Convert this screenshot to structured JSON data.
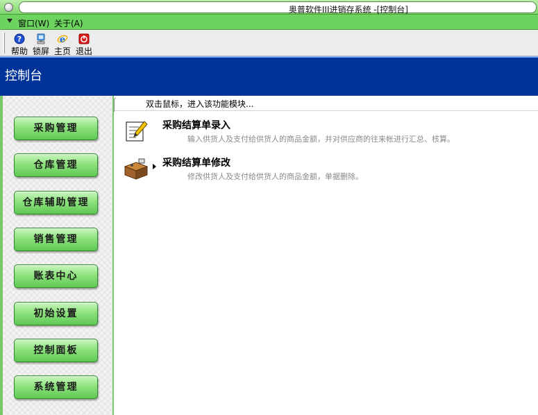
{
  "window": {
    "title": "奥普软件III进销存系统 -[控制台]"
  },
  "menu": {
    "items": [
      {
        "label": "窗口(W)"
      },
      {
        "label": "关于(A)"
      }
    ]
  },
  "toolbar": {
    "buttons": [
      {
        "label": "帮助",
        "icon": "help-icon"
      },
      {
        "label": "锁屏",
        "icon": "lock-screen-icon"
      },
      {
        "label": "主页",
        "icon": "home-ie-icon"
      },
      {
        "label": "退出",
        "icon": "exit-power-icon"
      }
    ]
  },
  "header": {
    "title": "控制台"
  },
  "sidebar": {
    "items": [
      {
        "label": "采购管理"
      },
      {
        "label": "仓库管理"
      },
      {
        "label": "仓库辅助管理"
      },
      {
        "label": "销售管理"
      },
      {
        "label": "账表中心"
      },
      {
        "label": "初始设置"
      },
      {
        "label": "控制面板"
      },
      {
        "label": "系统管理"
      }
    ]
  },
  "content": {
    "hint": "双击鼠标，进入该功能模块...",
    "functions": [
      {
        "name": "采购结算单录入",
        "description": "输入供货人及支付给供货人的商品金额，并对供应商的往来帐进行汇总、核算。",
        "icon": "notepad-pencil-icon"
      },
      {
        "name": "采购结算单修改",
        "description": "修改供货人及支付给供货人的商品金额，单据删除。",
        "icon": "desk-edit-icon"
      }
    ]
  },
  "colors": {
    "menu_green": "#6cd45e",
    "header_blue": "#003399",
    "nav_button_green": "#8ee27e"
  }
}
